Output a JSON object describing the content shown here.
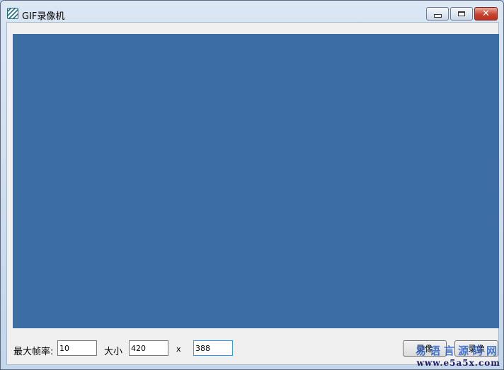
{
  "window": {
    "title": "GIF录像机",
    "icon": "gif-recorder-app-icon",
    "controls": {
      "minimize": "minimize-icon",
      "maximize": "maximize-icon",
      "close": "close-icon",
      "close_glyph": "✕"
    }
  },
  "preview": {
    "color": "#3c6ea5"
  },
  "controls": {
    "fps_label": "最大帧率:",
    "fps_value": "10",
    "size_label": "大小",
    "width_value": "420",
    "times_label": "x",
    "height_value": "388",
    "record_button_1": "录像",
    "record_button_2": "录像"
  },
  "watermark": {
    "line1": "易语言源码网",
    "line2": "www.e5a5x.com"
  },
  "colors": {
    "accent": "#3399ff",
    "close_red": "#c7412d",
    "watermark_blue": "#2a63c8"
  }
}
